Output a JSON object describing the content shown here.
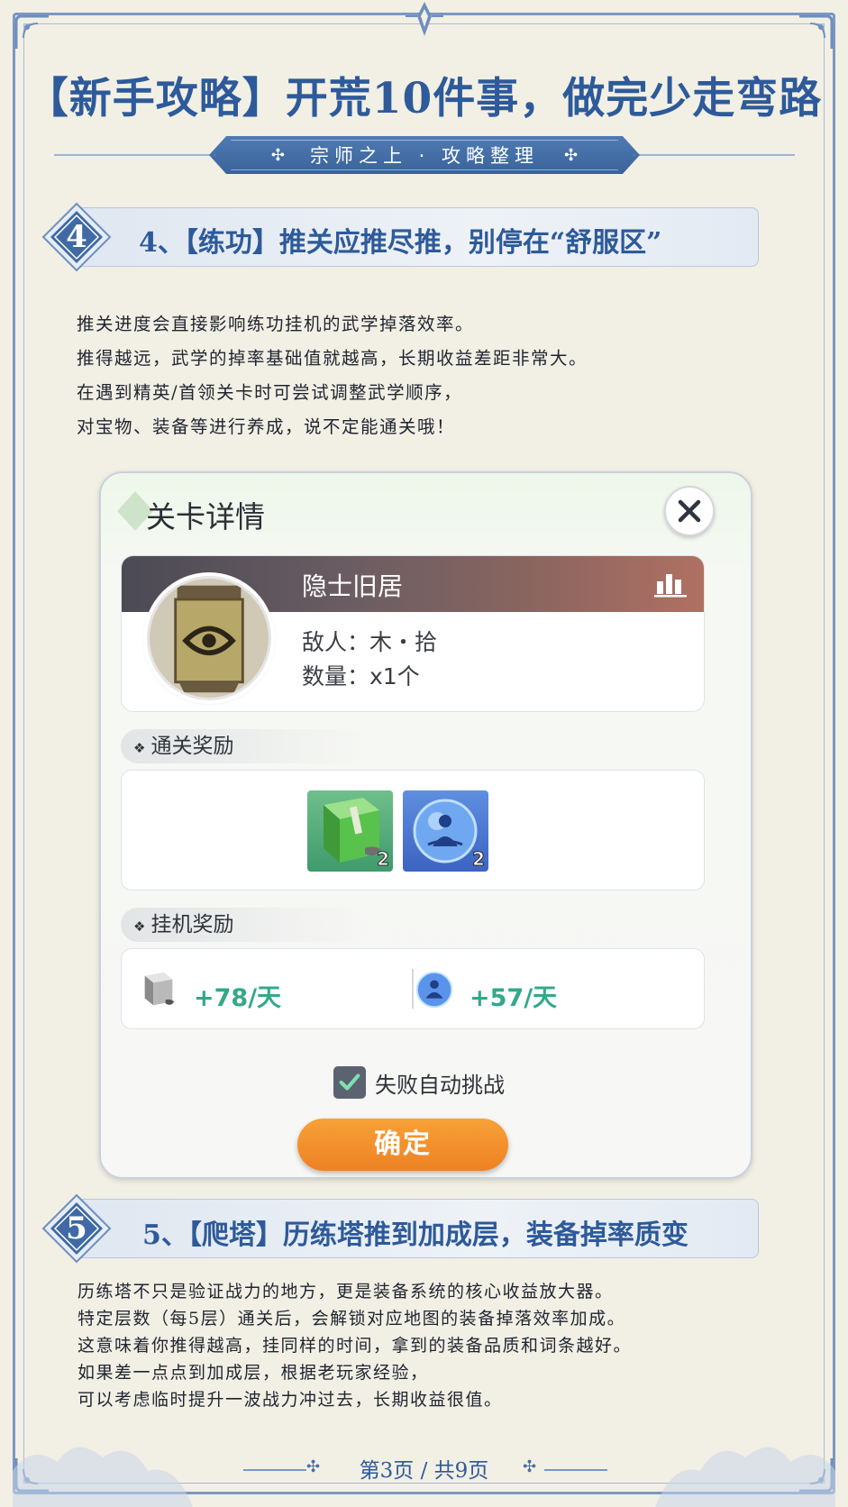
{
  "header": {
    "title": "【新手攻略】开荒10件事，做完少走弯路",
    "subtitle": "宗师之上 · 攻略整理"
  },
  "section4": {
    "number": "4",
    "title": "4、【练功】推关应推尽推，别停在“舒服区”",
    "lines": [
      "推关进度会直接影响练功挂机的武学掉落效率。",
      "推得越远，武学的掉率基础值就越高，长期收益差距非常大。",
      "在遇到精英/首领关卡时可尝试调整武学顺序，",
      "对宝物、装备等进行养成，说不定能通关哦！"
    ]
  },
  "dialog": {
    "title": "关卡详情",
    "close_icon": "close-icon",
    "stage": {
      "name": "隐士旧居",
      "enemy": "敌人：木・拾",
      "count": "数量：x1个"
    },
    "clear_rewards": {
      "label": "通关奖励",
      "items": [
        {
          "icon": "green-book-icon",
          "count": "2"
        },
        {
          "icon": "blue-orb-icon",
          "count": "2"
        }
      ]
    },
    "idle_rewards": {
      "label": "挂机奖励",
      "items": [
        {
          "icon": "grey-book-icon",
          "value": "+78/天"
        },
        {
          "icon": "blue-orb-icon",
          "value": "+57/天"
        }
      ]
    },
    "auto_challenge": {
      "label": "失败自动挑战",
      "checked": true
    },
    "confirm_label": "确定"
  },
  "section5": {
    "number": "5",
    "title": "5、【爬塔】历练塔推到加成层，装备掉率质变",
    "lines": [
      "历练塔不只是验证战力的地方，更是装备系统的核心收益放大器。",
      "特定层数（每5层）通关后，会解锁对应地图的装备掉落效率加成。",
      "这意味着你推得越高，挂同样的时间，拿到的装备品质和词条越好。",
      "如果差一点点到加成层，根据老玩家经验，",
      "可以考虑临时提升一波战力冲过去，长期收益很值。"
    ]
  },
  "footer": {
    "pagination": "第3页 / 共9页"
  },
  "colors": {
    "accent": "#2d5a9a",
    "confirm": "#ef8a2a",
    "idle_value": "#33a88a"
  }
}
